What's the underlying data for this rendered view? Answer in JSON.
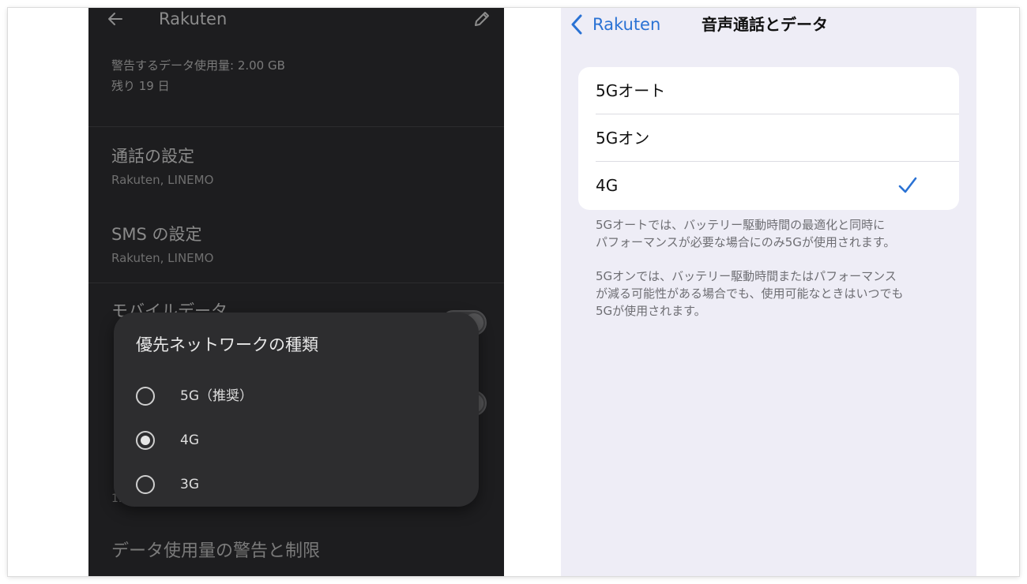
{
  "android": {
    "title": "Rakuten",
    "warning_text": "警告するデータ使用量: 2.00 GB",
    "days_left": "残り 19 日",
    "call_settings": {
      "title": "通話の設定",
      "subtitle": "Rakuten, LINEMO"
    },
    "sms_settings": {
      "title": "SMS の設定",
      "subtitle": "Rakuten, LINEMO"
    },
    "mobile_data": {
      "title": "モバイルデータ"
    },
    "peek_text": "1.",
    "data_warning_limit": "データ使用量の警告と制限",
    "dialog": {
      "title": "優先ネットワークの種類",
      "options": [
        {
          "label": "5G（推奨）",
          "selected": false
        },
        {
          "label": "4G",
          "selected": true
        },
        {
          "label": "3G",
          "selected": false
        }
      ]
    }
  },
  "ios": {
    "back_label": "Rakuten",
    "title": "音声通話とデータ",
    "options": [
      {
        "label": "5Gオート",
        "selected": false
      },
      {
        "label": "5Gオン",
        "selected": false
      },
      {
        "label": "4G",
        "selected": true
      }
    ],
    "note1": [
      "5Gオートでは、バッテリー駆動時間の最適化と同時に",
      "パフォーマンスが必要な場合にのみ5Gが使用されます。"
    ],
    "note2": [
      "5Gオンでは、バッテリー駆動時間またはパフォーマンス",
      "が減る可能性がある場合でも、使用可能なときはいつでも",
      "5Gが使用されます。"
    ],
    "accent_color": "#2a72d4"
  }
}
